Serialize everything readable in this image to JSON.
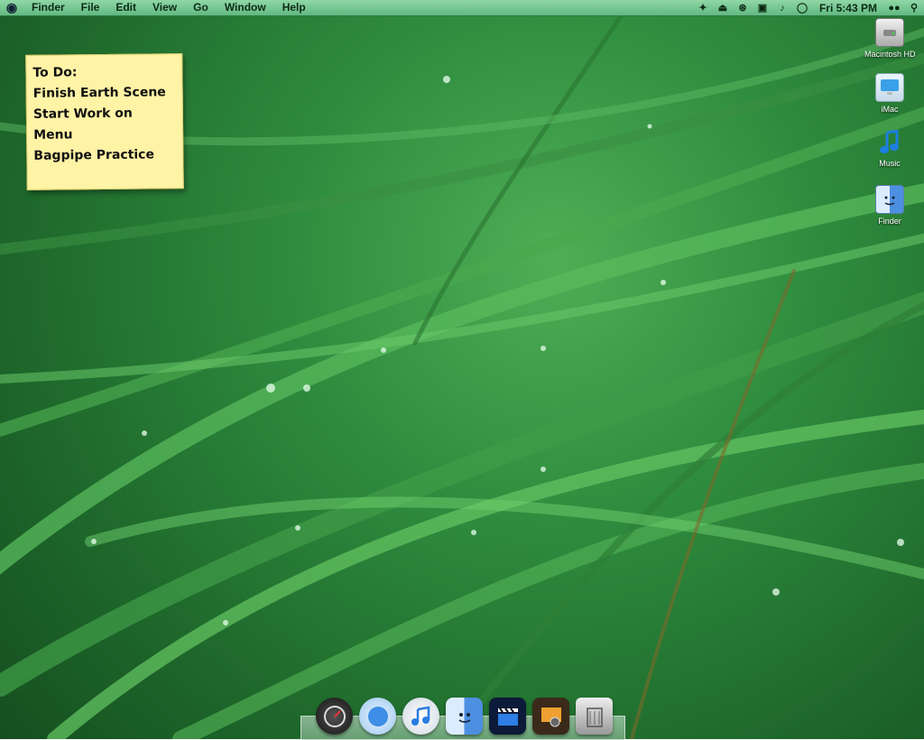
{
  "menubar": {
    "apple": "",
    "items": [
      "Finder",
      "File",
      "Edit",
      "View",
      "Go",
      "Window",
      "Help"
    ],
    "status_icons": [
      "script-icon",
      "eject-icon",
      "bluetooth-icon",
      "display-icon",
      "volume-icon",
      "ichat-icon"
    ],
    "clock": "Fri 5:43 PM",
    "user_icon": "users-icon",
    "search_icon": "spotlight-icon"
  },
  "sticky_note": {
    "lines": [
      "To Do:",
      "Finish Earth Scene",
      "Start Work on",
      "Menu",
      "Bagpipe Practice"
    ]
  },
  "desktop_icons": [
    {
      "label": "Macintosh HD",
      "icon": "hard-drive-icon"
    },
    {
      "label": "iMac",
      "icon": "imac-icon"
    },
    {
      "label": "Music",
      "icon": "music-note-icon"
    },
    {
      "label": "Finder",
      "icon": "finder-icon"
    }
  ],
  "dock": {
    "items": [
      "dashboard-icon",
      "safari-icon",
      "itunes-icon",
      "finder-icon",
      "imovie-icon",
      "iphoto-icon",
      "trash-icon"
    ]
  },
  "colors": {
    "menubar": "#79c894",
    "sticky": "#fff3a6",
    "wallpaper": "#2f8d3f"
  }
}
